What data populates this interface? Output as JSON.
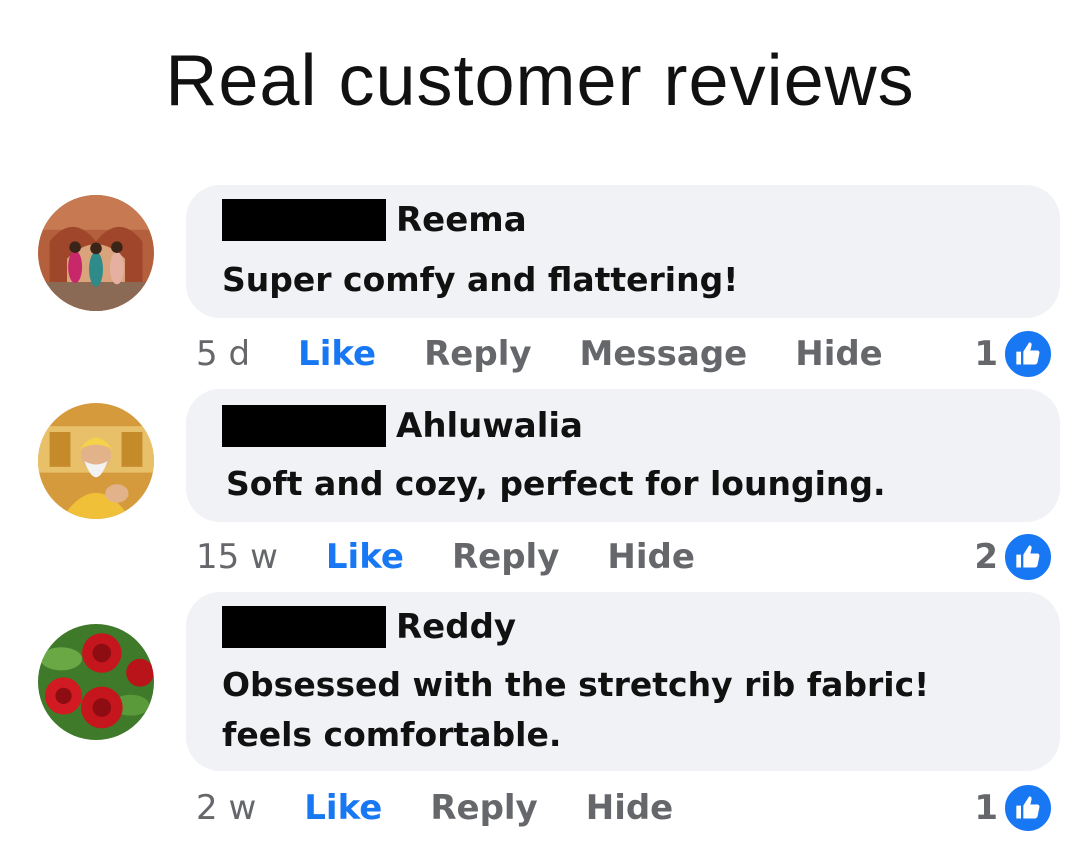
{
  "header": {
    "title": "Real customer reviews"
  },
  "colors": {
    "like": "#1877f2",
    "muted": "#65676b",
    "bubble": "#f0f2f5",
    "redaction": "#000000"
  },
  "reviews": [
    {
      "name": "Reema",
      "text": "Super comfy and flattering!",
      "time": "5 d",
      "like_label": "Like",
      "reply_label": "Reply",
      "message_label": "Message",
      "hide_label": "Hide",
      "reactions": "1",
      "avatar_icon": "women-in-palace-avatar"
    },
    {
      "name": "Ahluwalia",
      "text": "Soft and cozy, perfect for lounging.",
      "time": "15 w",
      "like_label": "Like",
      "reply_label": "Reply",
      "hide_label": "Hide",
      "reactions": "2",
      "avatar_icon": "guru-portrait-avatar"
    },
    {
      "name": "Reddy",
      "text": "Obsessed with the stretchy rib fabric! feels comfortable.",
      "time": "2 w",
      "like_label": "Like",
      "reply_label": "Reply",
      "hide_label": "Hide",
      "reactions": "1",
      "avatar_icon": "red-roses-avatar"
    }
  ]
}
